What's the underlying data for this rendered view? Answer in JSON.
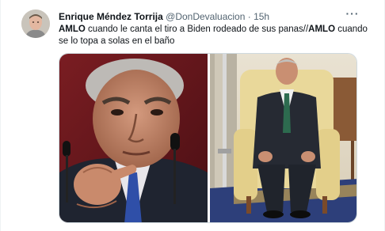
{
  "tweet": {
    "author_name": "Enrique Méndez Torrija",
    "author_handle": "@DonDevaluacion",
    "separator": "·",
    "time": "15h",
    "more_label": "···",
    "text_part1_bold": "AMLO",
    "text_part2": " cuando le canta el tiro a Biden rodeado de sus panas//",
    "text_part3_bold": "AMLO",
    "text_part4": " cuando se lo topa a solas en el baño"
  },
  "media": {
    "left_photo": "man-pointing-photo",
    "right_photo": "man-seated-in-armchair-photo"
  },
  "colors": {
    "text": "#0f1419",
    "secondary": "#536471",
    "border": "#cfd9de"
  },
  "icons": {
    "more": "more-horizontal-icon"
  }
}
